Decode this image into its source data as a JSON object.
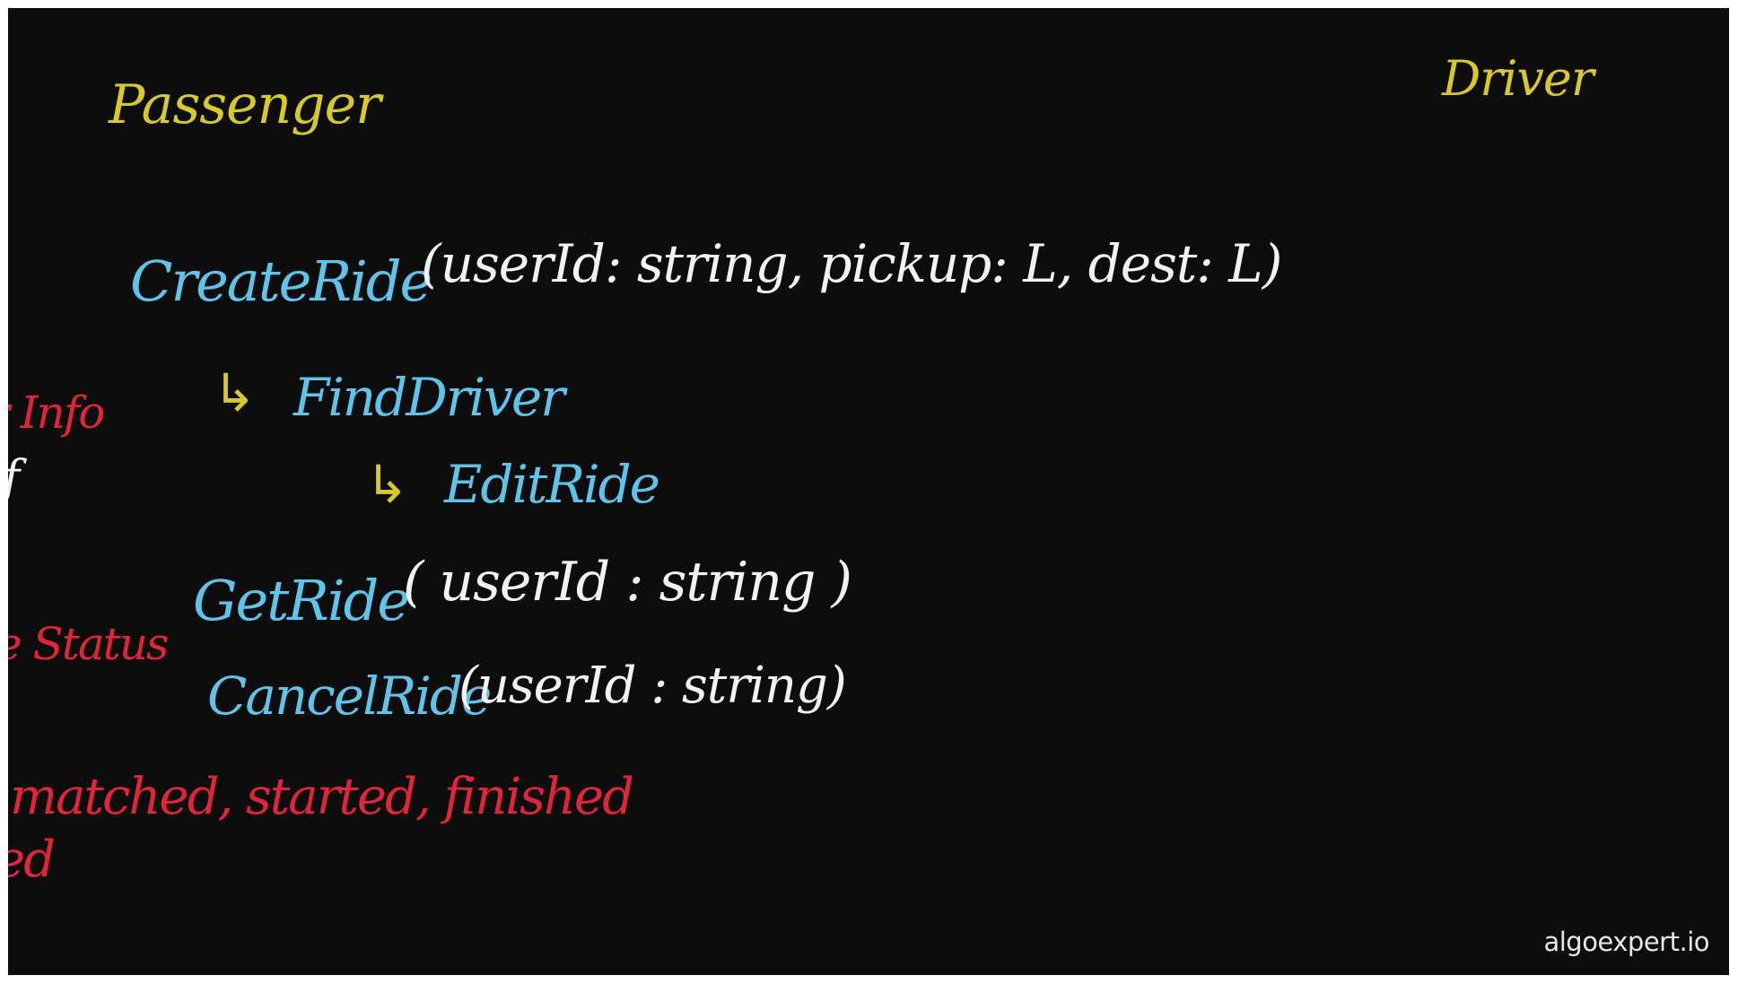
{
  "headers": {
    "passenger": "Passenger",
    "driver": "Driver"
  },
  "api": {
    "create_ride": {
      "name": "CreateRide",
      "params": "(userId: string, pickup: L, dest: L)"
    },
    "find_driver": {
      "arrow": "↳",
      "name": "FindDriver"
    },
    "edit_ride": {
      "arrow": "↳",
      "name": "EditRide"
    },
    "get_ride": {
      "name": "GetRide",
      "params": "( userId : string )"
    },
    "cancel_ride": {
      "name": "CancelRide",
      "params": "(userId : string)"
    }
  },
  "left_notes": {
    "info": "r Info",
    "white_glyph": "f",
    "status": "e Status",
    "states": "matched, started, finished",
    "ed": "ed"
  },
  "watermark": "algoexpert.io",
  "colors": {
    "background": "#0d0d0d",
    "yellow": "#d8c92a",
    "blue": "#5fc3ea",
    "white": "#f2f2f2",
    "red": "#e0243a"
  }
}
